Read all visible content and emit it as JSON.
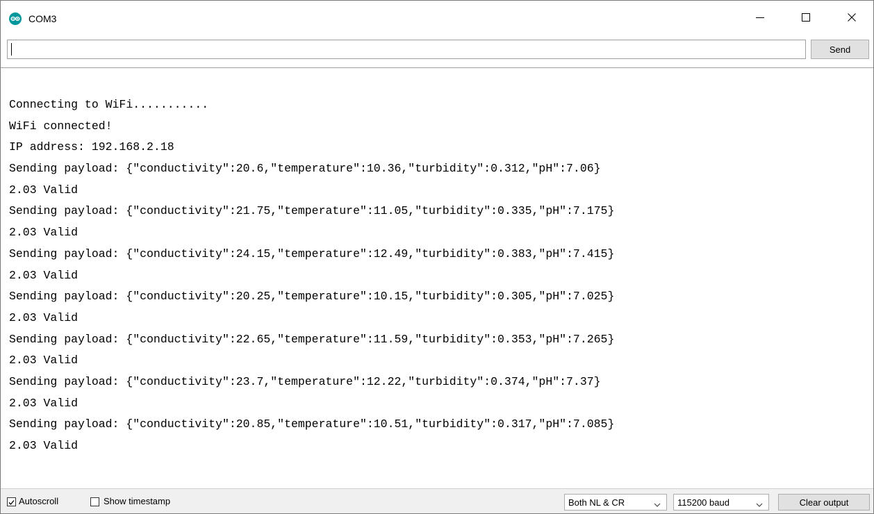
{
  "window": {
    "title": "COM3"
  },
  "input": {
    "value": "",
    "send_label": "Send"
  },
  "output": {
    "lines": [
      "Connecting to WiFi...........",
      "WiFi connected!",
      "IP address: 192.168.2.18",
      "Sending payload: {\"conductivity\":20.6,\"temperature\":10.36,\"turbidity\":0.312,\"pH\":7.06}",
      "2.03 Valid",
      "Sending payload: {\"conductivity\":21.75,\"temperature\":11.05,\"turbidity\":0.335,\"pH\":7.175}",
      "2.03 Valid",
      "Sending payload: {\"conductivity\":24.15,\"temperature\":12.49,\"turbidity\":0.383,\"pH\":7.415}",
      "2.03 Valid",
      "Sending payload: {\"conductivity\":20.25,\"temperature\":10.15,\"turbidity\":0.305,\"pH\":7.025}",
      "2.03 Valid",
      "Sending payload: {\"conductivity\":22.65,\"temperature\":11.59,\"turbidity\":0.353,\"pH\":7.265}",
      "2.03 Valid",
      "Sending payload: {\"conductivity\":23.7,\"temperature\":12.22,\"turbidity\":0.374,\"pH\":7.37}",
      "2.03 Valid",
      "Sending payload: {\"conductivity\":20.85,\"temperature\":10.51,\"turbidity\":0.317,\"pH\":7.085}",
      "2.03 Valid"
    ]
  },
  "statusbar": {
    "autoscroll": {
      "label": "Autoscroll",
      "checked": true
    },
    "show_timestamp": {
      "label": "Show timestamp",
      "checked": false
    },
    "line_ending": "Both NL & CR",
    "baud_rate": "115200 baud",
    "clear_label": "Clear output"
  },
  "icons": {
    "app": "arduino-icon",
    "minimize": "minimize-icon",
    "maximize": "maximize-icon",
    "close": "close-icon",
    "checkmark": "checkmark-icon",
    "chevron": "chevron-down-icon"
  },
  "colors": {
    "arduino_teal": "#00979C",
    "window_bg": "#ffffff",
    "statusbar_bg": "#f0f0f0",
    "button_bg": "#e1e1e1"
  }
}
